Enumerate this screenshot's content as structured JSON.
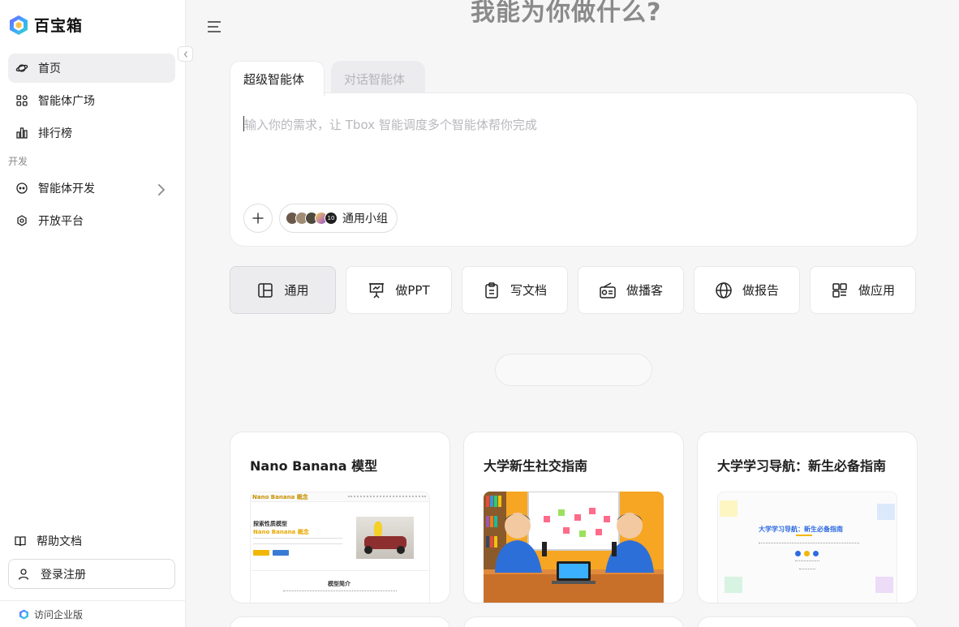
{
  "app": {
    "name": "百宝箱"
  },
  "sidebar": {
    "items": [
      {
        "label": "首页",
        "icon": "planet-icon",
        "active": true
      },
      {
        "label": "智能体广场",
        "icon": "apps-icon"
      },
      {
        "label": "排行榜",
        "icon": "bar-chart-icon"
      }
    ],
    "section_dev": "开发",
    "dev_items": [
      {
        "label": "智能体开发",
        "icon": "robot-icon",
        "has_children": true
      },
      {
        "label": "开放平台",
        "icon": "platform-icon"
      }
    ],
    "help_label": "帮助文档",
    "login_label": "登录注册",
    "footer_label": "访问企业版"
  },
  "main": {
    "hero_title": "我能为你做什么?",
    "tabs": [
      {
        "label": "超级智能体",
        "active": true
      },
      {
        "label": "对话智能体",
        "active": false
      }
    ],
    "input": {
      "placeholder": "输入你的需求，让 Tbox 智能调度多个智能体帮你完成",
      "group_label": "通用小组",
      "avatar_count": "10"
    },
    "categories": [
      {
        "label": "通用",
        "icon": "layout-icon",
        "active": true
      },
      {
        "label": "做PPT",
        "icon": "presentation-icon"
      },
      {
        "label": "写文档",
        "icon": "clipboard-icon"
      },
      {
        "label": "做播客",
        "icon": "radio-icon"
      },
      {
        "label": "做报告",
        "icon": "globe-icon"
      },
      {
        "label": "做应用",
        "icon": "app-grid-icon"
      }
    ],
    "cards": [
      {
        "title": "Nano Banana 模型",
        "preview": {
          "brand": "Nano Banana 概念",
          "headline1": "探索性质模型",
          "headline2": "Nano Banana 概念",
          "section": "模型简介"
        }
      },
      {
        "title": "大学新生社交指南"
      },
      {
        "title": "大学学习导航：新生必备指南",
        "preview": {
          "headline": "大学学习导航：新生必备指南"
        }
      }
    ]
  },
  "colors": {
    "accent_yellow": "#f2b705",
    "podcast_bg": "#f6a623",
    "shirt_blue": "#2d6fd8",
    "guide_blue": "#2f6be0"
  }
}
